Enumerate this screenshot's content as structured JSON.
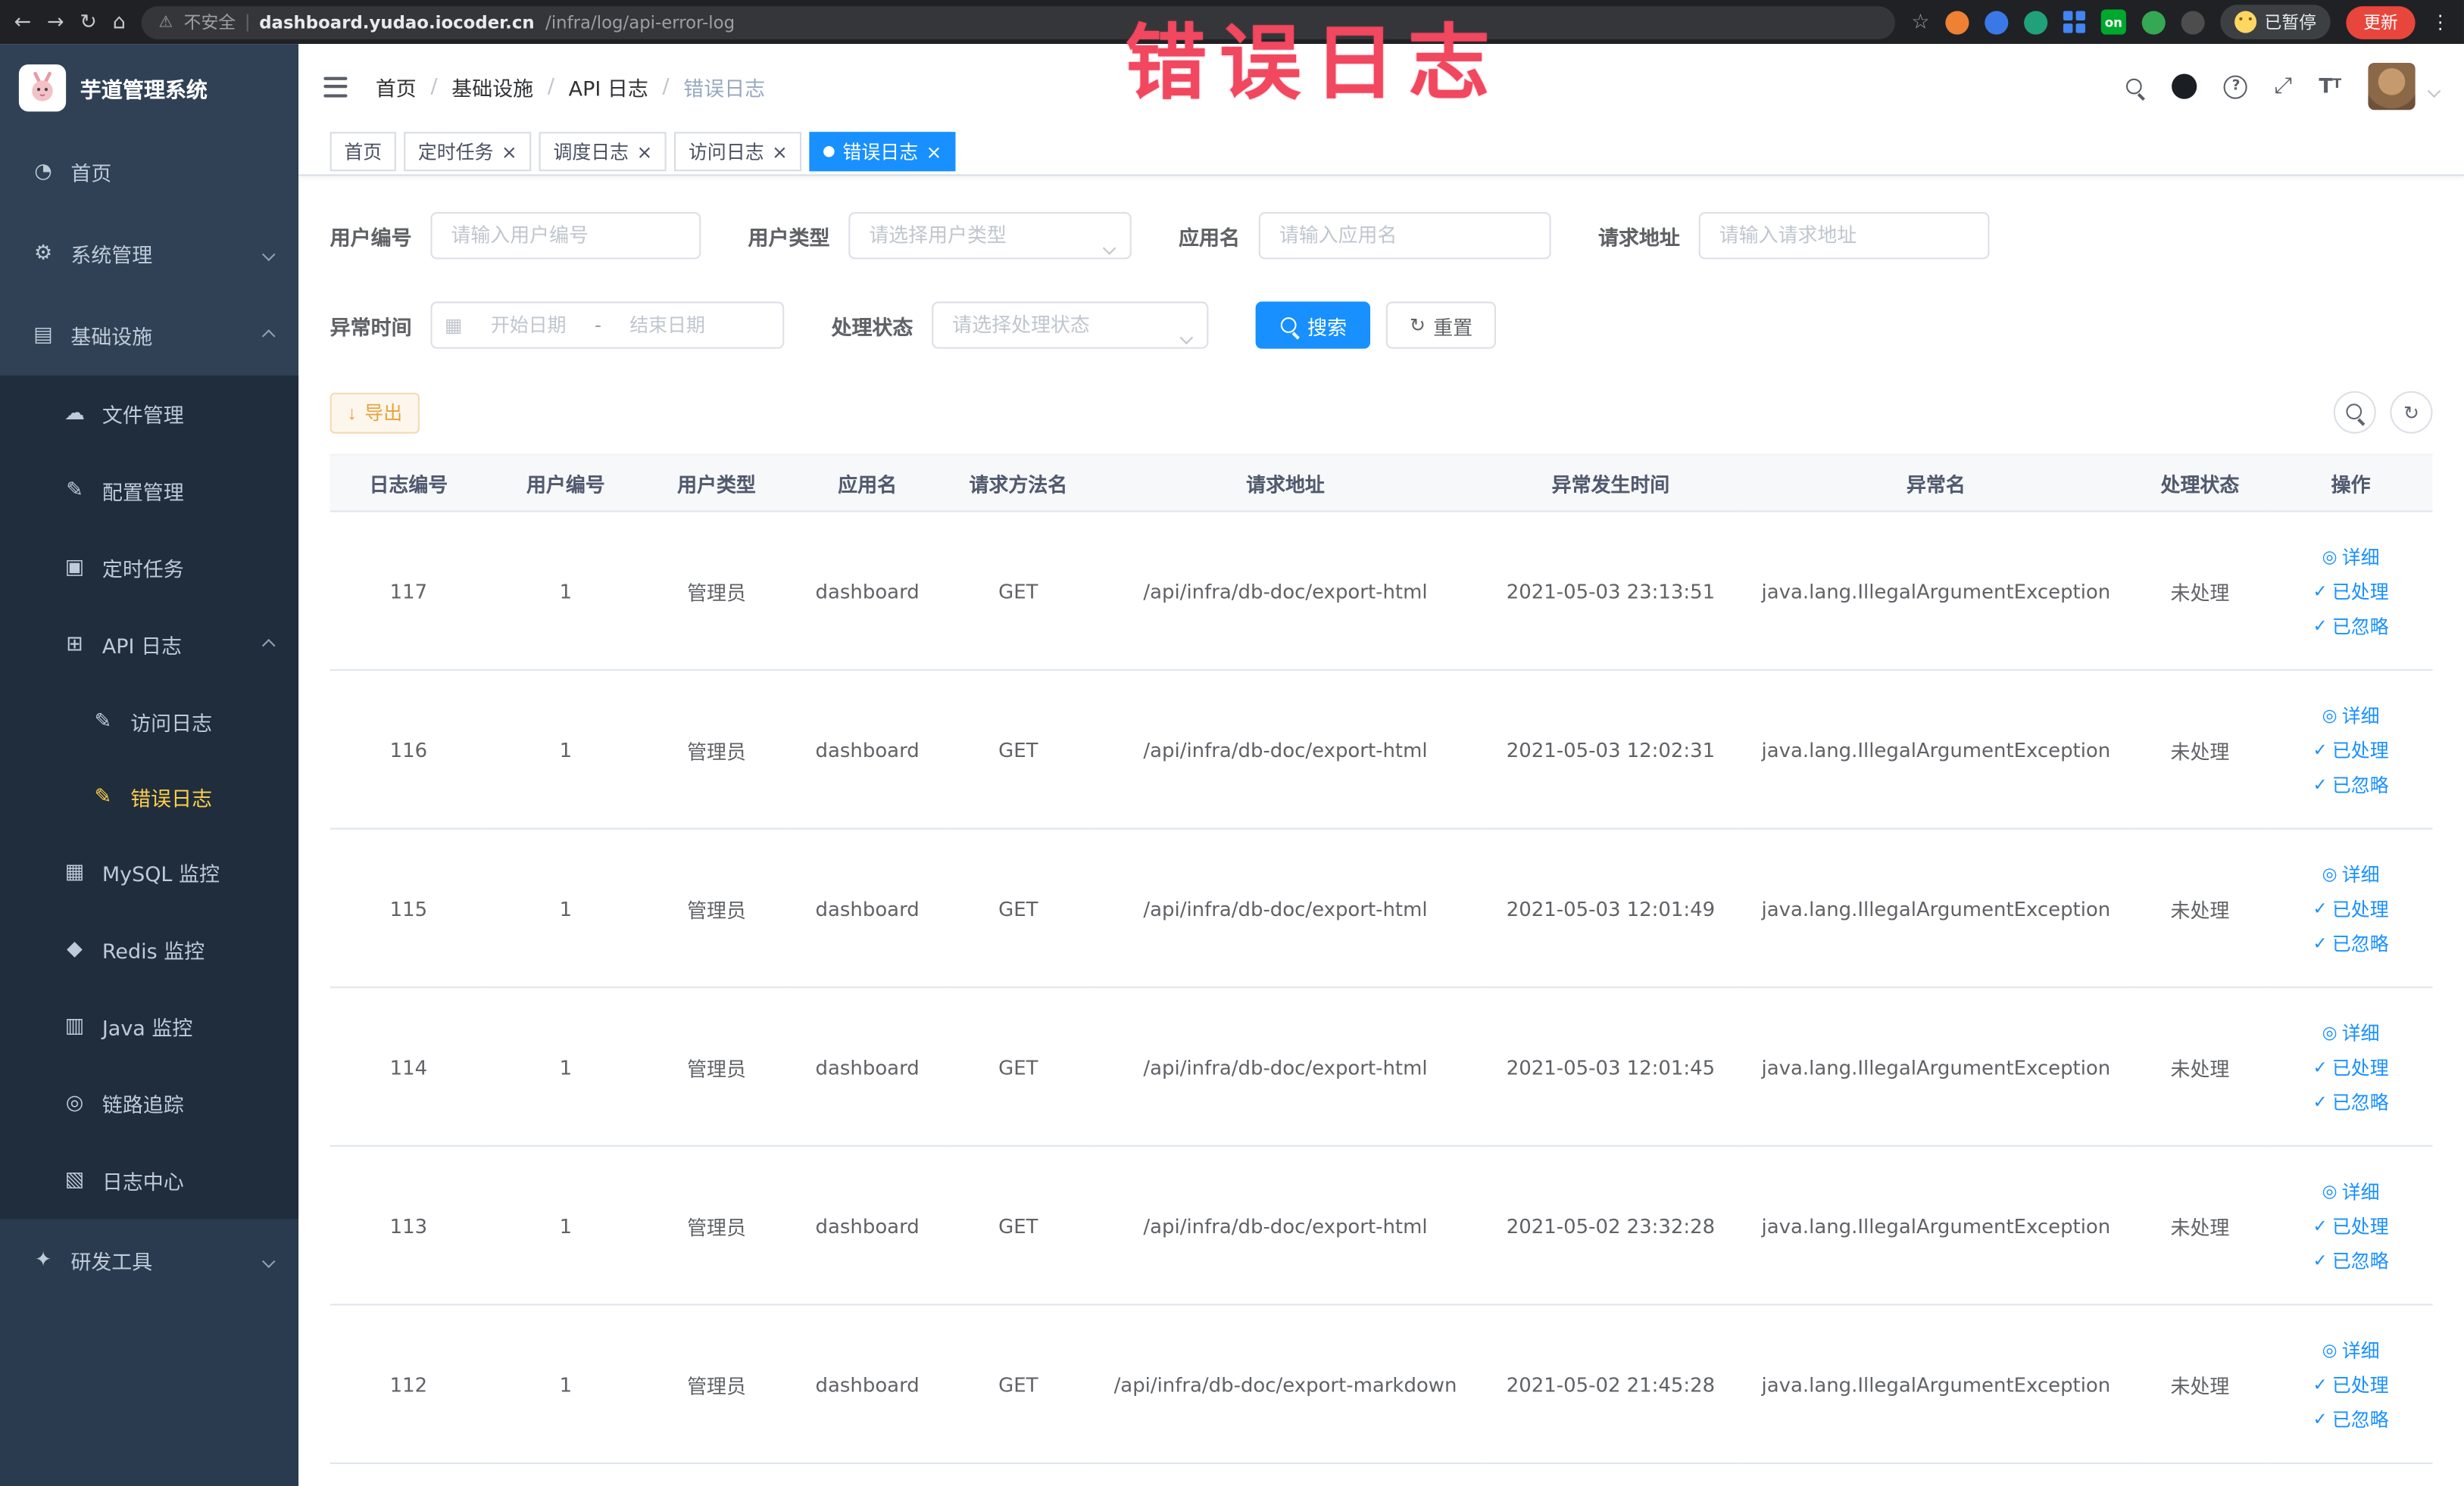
{
  "browser": {
    "security_label": "不安全",
    "url_host": "dashboard.yudao.iocoder.cn",
    "url_path": "/infra/log/api-error-log",
    "extension_badge": "on",
    "paused_badge": "已暂停",
    "update_button": "更新"
  },
  "annotation": {
    "text": "错误日志"
  },
  "sidebar": {
    "logo_title": "芋道管理系统",
    "items": [
      {
        "label": "首页"
      },
      {
        "label": "系统管理"
      },
      {
        "label": "基础设施"
      },
      {
        "label": "文件管理"
      },
      {
        "label": "配置管理"
      },
      {
        "label": "定时任务"
      },
      {
        "label": "API 日志"
      },
      {
        "label": "访问日志"
      },
      {
        "label": "错误日志"
      },
      {
        "label": "MySQL 监控"
      },
      {
        "label": "Redis 监控"
      },
      {
        "label": "Java 监控"
      },
      {
        "label": "链路追踪"
      },
      {
        "label": "日志中心"
      },
      {
        "label": "研发工具"
      }
    ]
  },
  "header": {
    "breadcrumb": [
      "首页",
      "基础设施",
      "API 日志",
      "错误日志"
    ]
  },
  "tabs": [
    {
      "label": "首页"
    },
    {
      "label": "定时任务"
    },
    {
      "label": "调度日志"
    },
    {
      "label": "访问日志"
    },
    {
      "label": "错误日志"
    }
  ],
  "filters": {
    "user_id": {
      "label": "用户编号",
      "placeholder": "请输入用户编号"
    },
    "user_type": {
      "label": "用户类型",
      "placeholder": "请选择用户类型"
    },
    "app_name": {
      "label": "应用名",
      "placeholder": "请输入应用名"
    },
    "request_url": {
      "label": "请求地址",
      "placeholder": "请输入请求地址"
    },
    "exception_time": {
      "label": "异常时间",
      "start_placeholder": "开始日期",
      "separator": "-",
      "end_placeholder": "结束日期"
    },
    "process_status": {
      "label": "处理状态",
      "placeholder": "请选择处理状态"
    },
    "search_button": "搜索",
    "reset_button": "重置"
  },
  "toolbar": {
    "export_button": "导出"
  },
  "table": {
    "columns": [
      "日志编号",
      "用户编号",
      "用户类型",
      "应用名",
      "请求方法名",
      "请求地址",
      "异常发生时间",
      "异常名",
      "处理状态",
      "操作"
    ],
    "actions": {
      "detail": "详细",
      "processed": "已处理",
      "ignored": "已忽略"
    },
    "rows": [
      {
        "id": "117",
        "user_id": "1",
        "user_type": "管理员",
        "app": "dashboard",
        "method": "GET",
        "url": "/api/infra/db-doc/export-html",
        "time": "2021-05-03 23:13:51",
        "exception": "java.lang.IllegalArgumentException",
        "status": "未处理"
      },
      {
        "id": "116",
        "user_id": "1",
        "user_type": "管理员",
        "app": "dashboard",
        "method": "GET",
        "url": "/api/infra/db-doc/export-html",
        "time": "2021-05-03 12:02:31",
        "exception": "java.lang.IllegalArgumentException",
        "status": "未处理"
      },
      {
        "id": "115",
        "user_id": "1",
        "user_type": "管理员",
        "app": "dashboard",
        "method": "GET",
        "url": "/api/infra/db-doc/export-html",
        "time": "2021-05-03 12:01:49",
        "exception": "java.lang.IllegalArgumentException",
        "status": "未处理"
      },
      {
        "id": "114",
        "user_id": "1",
        "user_type": "管理员",
        "app": "dashboard",
        "method": "GET",
        "url": "/api/infra/db-doc/export-html",
        "time": "2021-05-03 12:01:45",
        "exception": "java.lang.IllegalArgumentException",
        "status": "未处理"
      },
      {
        "id": "113",
        "user_id": "1",
        "user_type": "管理员",
        "app": "dashboard",
        "method": "GET",
        "url": "/api/infra/db-doc/export-html",
        "time": "2021-05-02 23:32:28",
        "exception": "java.lang.IllegalArgumentException",
        "status": "未处理"
      },
      {
        "id": "112",
        "user_id": "1",
        "user_type": "管理员",
        "app": "dashboard",
        "method": "GET",
        "url": "/api/infra/db-doc/export-markdown",
        "time": "2021-05-02 21:45:28",
        "exception": "java.lang.IllegalArgumentException",
        "status": "未处理"
      }
    ]
  }
}
